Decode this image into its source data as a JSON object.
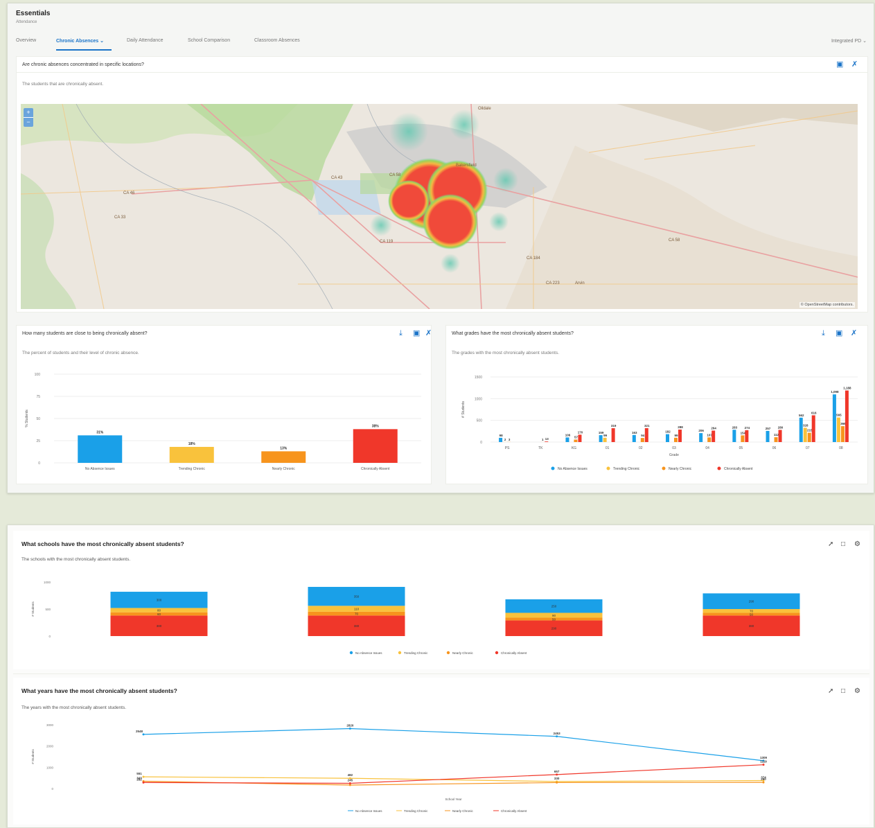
{
  "app": {
    "title": "Essentials",
    "subtitle": "Attendance",
    "org_selector": "Integrated PD"
  },
  "tabs": [
    {
      "label": "Overview",
      "active": false
    },
    {
      "label": "Chronic Absences",
      "active": true
    },
    {
      "label": "Daily Attendance",
      "active": false
    },
    {
      "label": "School Comparison",
      "active": false
    },
    {
      "label": "Classroom Absences",
      "active": false
    }
  ],
  "map_card": {
    "title": "Are chronic absences concentrated in specific locations?",
    "subtitle": "The students that are chronically absent.",
    "zoom_in": "+",
    "zoom_out": "−",
    "attribution": "© OpenStreetMap contributors.",
    "place_labels": [
      "Bakersfield",
      "CA 58",
      "CA 43",
      "CA 119",
      "CA 184",
      "CA 223",
      "CA 33",
      "CA 46",
      "CA 65",
      "Arvin",
      "Oildale"
    ]
  },
  "levels_card": {
    "title": "How many students are close to being chronically absent?",
    "subtitle": "The percent of students and their level of chronic absence.",
    "chart_data": {
      "type": "bar",
      "ylabel": "% Students",
      "ylim": [
        0,
        100
      ],
      "yticks": [
        "100",
        "75",
        "50",
        "25",
        "0"
      ],
      "categories": [
        "No Absence Issues",
        "Trending Chronic",
        "Nearly Chronic",
        "Chronically Absent"
      ],
      "values": [
        31,
        18,
        13,
        38
      ],
      "labels": [
        "31%",
        "18%",
        "13%",
        "38%"
      ],
      "colors": [
        "#1aa0e8",
        "#f9c23c",
        "#f7941d",
        "#f0372a"
      ]
    }
  },
  "grades_card": {
    "title": "What grades have the most chronically absent students?",
    "subtitle": "The grades with the most chronically absent students.",
    "chart_data": {
      "type": "bar",
      "xlabel": "Grade",
      "ylabel": "# Students",
      "ylim": [
        0,
        1500
      ],
      "yticks": [
        "1500",
        "1000",
        "500",
        "0"
      ],
      "categories": [
        "PS",
        "TK",
        "KG",
        "01",
        "02",
        "03",
        "04",
        "05",
        "06",
        "07",
        "08"
      ],
      "series": [
        {
          "name": "No Absence Issues",
          "color": "#1aa0e8",
          "values": [
            98,
            0,
            106,
            159,
            163,
            182,
            206,
            283,
            257,
            562,
            1098
          ]
        },
        {
          "name": "Trending Chronic",
          "color": "#f9c23c",
          "values": [
            2,
            0,
            0,
            99,
            0,
            0,
            0,
            0,
            0,
            328,
            565
          ]
        },
        {
          "name": "Nearly Chronic",
          "color": "#f7941d",
          "values": [
            3,
            1,
            57,
            0,
            94,
            99,
            107,
            154,
            112,
            215,
            366
          ]
        },
        {
          "name": "Chronically Absent",
          "color": "#f0372a",
          "values": [
            0,
            13,
            170,
            319,
            321,
            288,
            264,
            274,
            280,
            616,
            1188
          ]
        }
      ],
      "labels": [
        [
          "98",
          "",
          "106",
          "159",
          "163",
          "182",
          "206",
          "283",
          "257",
          "562",
          "1,098"
        ],
        [
          "2",
          "",
          "",
          "99",
          "",
          "",
          "",
          "",
          "",
          "328",
          "565"
        ],
        [
          "3",
          "1",
          "57",
          "",
          "94",
          "99",
          "107",
          "154",
          "112",
          "215",
          "366"
        ],
        [
          "",
          "13",
          "170",
          "319",
          "321",
          "288",
          "264",
          "274",
          "280",
          "616",
          "1,188"
        ]
      ],
      "legend": [
        "No Absence Issues",
        "Trending Chronic",
        "Nearly Chronic",
        "Chronically Absent"
      ]
    }
  },
  "schools_card": {
    "title": "What schools have the most chronically absent students?",
    "subtitle": "The schools with the most chronically absent students.",
    "chart_data": {
      "type": "bar",
      "stacked": true,
      "ylabel": "# Students",
      "ylim": [
        0,
        1000
      ],
      "yticks": [
        "1000",
        "500",
        "0"
      ],
      "categories": [
        "",
        "",
        "",
        ""
      ],
      "series": [
        {
          "name": "No Absence Issues",
          "color": "#1aa0e8",
          "values": [
            300,
            350,
            250,
            290
          ]
        },
        {
          "name": "Trending Chronic",
          "color": "#f9c23c",
          "values": [
            80,
            110,
            90,
            70
          ]
        },
        {
          "name": "Nearly Chronic",
          "color": "#f7941d",
          "values": [
            60,
            70,
            50,
            50
          ]
        },
        {
          "name": "Chronically Absent",
          "color": "#f0372a",
          "values": [
            380,
            380,
            290,
            380
          ]
        }
      ],
      "legend": [
        "No Absence Issues",
        "Trending Chronic",
        "Nearly Chronic",
        "Chronically Absent"
      ]
    }
  },
  "years_card": {
    "title": "What years have the most chronically absent students?",
    "subtitle": "The years with the most chronically absent students.",
    "chart_data": {
      "type": "line",
      "ylabel": "# Students",
      "xlabel": "School Year",
      "ylim": [
        0,
        3000
      ],
      "yticks": [
        "3000",
        "2000",
        "1000",
        "0"
      ],
      "x": [
        "",
        "",
        "",
        ""
      ],
      "series": [
        {
          "name": "No Absence Issues",
          "color": "#1aa0e8",
          "values": [
            2548,
            2820,
            2453,
            1309
          ]
        },
        {
          "name": "Trending Chronic",
          "color": "#f9c23c",
          "values": [
            551,
            482,
            330,
            374
          ]
        },
        {
          "name": "Nearly Chronic",
          "color": "#f7941d",
          "values": [
            343,
            162,
            280,
            290
          ]
        },
        {
          "name": "Chronically Absent",
          "color": "#f0372a",
          "values": [
            282,
            245,
            657,
            1119
          ]
        }
      ],
      "labels": [
        [
          "2548",
          "2820",
          "2453",
          "1309"
        ],
        [
          "551",
          "482",
          "330",
          "374"
        ],
        [
          "343",
          "",
          "",
          "290"
        ],
        [
          "282",
          "245",
          "657",
          "1119"
        ]
      ],
      "legend": [
        "No Absence Issues",
        "Trending Chronic",
        "Nearly Chronic",
        "Chronically Absent"
      ]
    }
  }
}
